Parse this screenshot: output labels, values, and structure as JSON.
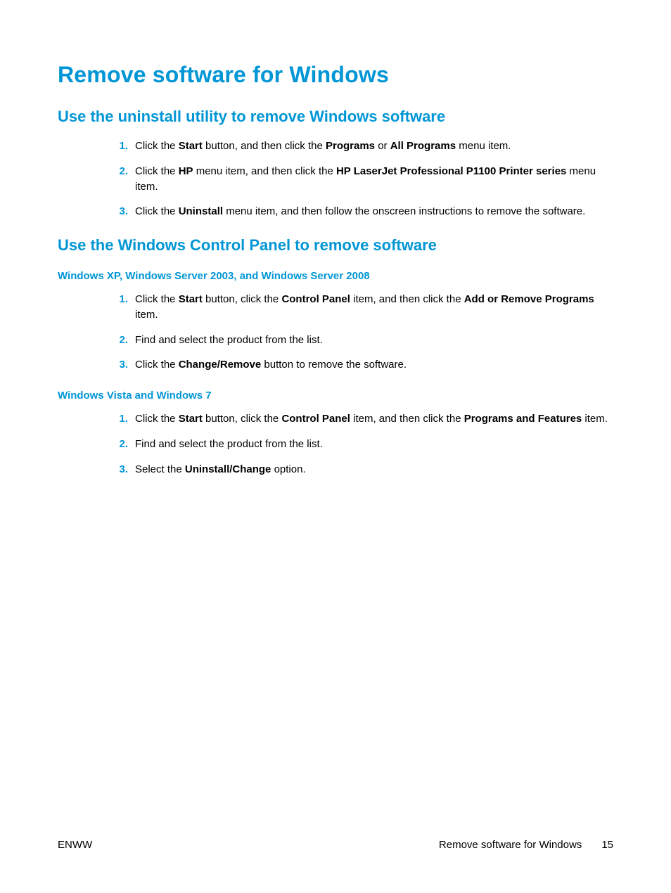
{
  "title": "Remove software for Windows",
  "section1": {
    "heading": "Use the uninstall utility to remove Windows software",
    "steps": [
      {
        "pre": "Click the ",
        "b1": "Start",
        "mid1": " button, and then click the ",
        "b2": "Programs",
        "mid2": " or ",
        "b3": "All Programs",
        "post": " menu item."
      },
      {
        "pre": "Click the ",
        "b1": "HP",
        "mid1": " menu item, and then click the ",
        "b2": "HP LaserJet Professional P1100 Printer series",
        "post": " menu item."
      },
      {
        "pre": "Click the ",
        "b1": "Uninstall",
        "post": " menu item, and then follow the onscreen instructions to remove the software."
      }
    ]
  },
  "section2": {
    "heading": "Use the Windows Control Panel to remove software",
    "sub1": {
      "heading": "Windows XP, Windows Server 2003, and Windows Server 2008",
      "steps": [
        {
          "pre": "Click the ",
          "b1": "Start",
          "mid1": " button, click the ",
          "b2": "Control Panel",
          "mid2": " item, and then click the ",
          "b3": "Add or Remove Programs",
          "post": " item."
        },
        {
          "pre": "Find and select the product from the list."
        },
        {
          "pre": "Click the ",
          "b1": "Change/Remove",
          "post": " button to remove the software."
        }
      ]
    },
    "sub2": {
      "heading": "Windows Vista and Windows 7",
      "steps": [
        {
          "pre": "Click the ",
          "b1": "Start",
          "mid1": " button, click the ",
          "b2": "Control Panel",
          "mid2": " item, and then click the ",
          "b3": "Programs and Features",
          "post": " item."
        },
        {
          "pre": "Find and select the product from the list."
        },
        {
          "pre": "Select the ",
          "b1": "Uninstall/Change",
          "post": " option."
        }
      ]
    }
  },
  "footer": {
    "left": "ENWW",
    "rightText": "Remove software for Windows",
    "pageNum": "15"
  }
}
